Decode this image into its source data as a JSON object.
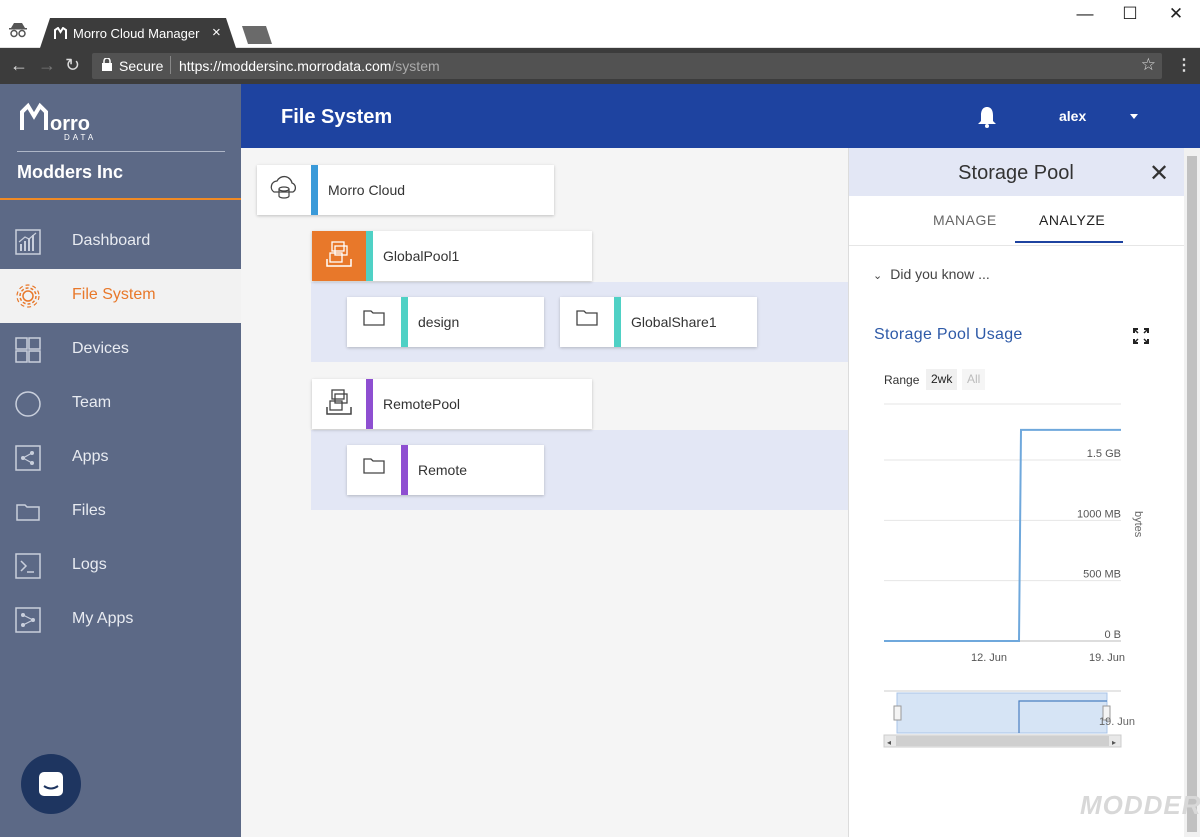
{
  "browser": {
    "tab_title": "Morro Cloud Manager",
    "tab_close": "×",
    "secure_label": "Secure",
    "url_host": "https://moddersinc.morrodata.com",
    "url_path": "/system",
    "minimize": "—",
    "maximize": "☐",
    "close": "✕"
  },
  "sidebar": {
    "org_name": "Modders Inc",
    "items": [
      {
        "label": "Dashboard",
        "icon": "dashboard-icon"
      },
      {
        "label": "File System",
        "icon": "gear-icon"
      },
      {
        "label": "Devices",
        "icon": "devices-icon"
      },
      {
        "label": "Team",
        "icon": "team-icon"
      },
      {
        "label": "Apps",
        "icon": "apps-icon"
      },
      {
        "label": "Files",
        "icon": "folder-icon"
      },
      {
        "label": "Logs",
        "icon": "terminal-icon"
      },
      {
        "label": "My Apps",
        "icon": "my-apps-icon"
      }
    ],
    "active_index": 1
  },
  "header": {
    "title": "File System",
    "user": "alex"
  },
  "tree": {
    "root": {
      "label": "Morro Cloud",
      "color": "#3a9ad9"
    },
    "global_pool": {
      "label": "GlobalPool1",
      "color": "#4fd1c5"
    },
    "global_shares": [
      {
        "label": "design",
        "color": "#4fd1c5"
      },
      {
        "label": "GlobalShare1",
        "color": "#4fd1c5"
      }
    ],
    "remote_pool": {
      "label": "RemotePool",
      "color": "#8e4fd1"
    },
    "remote_shares": [
      {
        "label": "Remote",
        "color": "#8e4fd1"
      }
    ]
  },
  "panel": {
    "title": "Storage Pool",
    "tabs": [
      "MANAGE",
      "ANALYZE"
    ],
    "active_tab": "ANALYZE",
    "did_you_know": "Did you know ...",
    "usage_title": "Storage Pool Usage",
    "range_label": "Range",
    "range_options": [
      "2wk",
      "All"
    ],
    "range_selected": "2wk"
  },
  "chart_data": {
    "type": "line",
    "ylabel": "bytes",
    "y_ticks": [
      "0 B",
      "500 MB",
      "1000 MB",
      "1.5 GB"
    ],
    "x_ticks": [
      "12. Jun",
      "19. Jun"
    ],
    "navigator_tick": "19. Jun",
    "series": [
      {
        "x": [
          "2017-06-05",
          "2017-06-15",
          "2017-06-15",
          "2017-06-19"
        ],
        "values": [
          0,
          0,
          1.75,
          1.75
        ],
        "unit": "GB"
      }
    ],
    "ylim": [
      0,
      2
    ],
    "grid": true,
    "color": "#6fa8dc"
  },
  "watermark": "MODDERS"
}
